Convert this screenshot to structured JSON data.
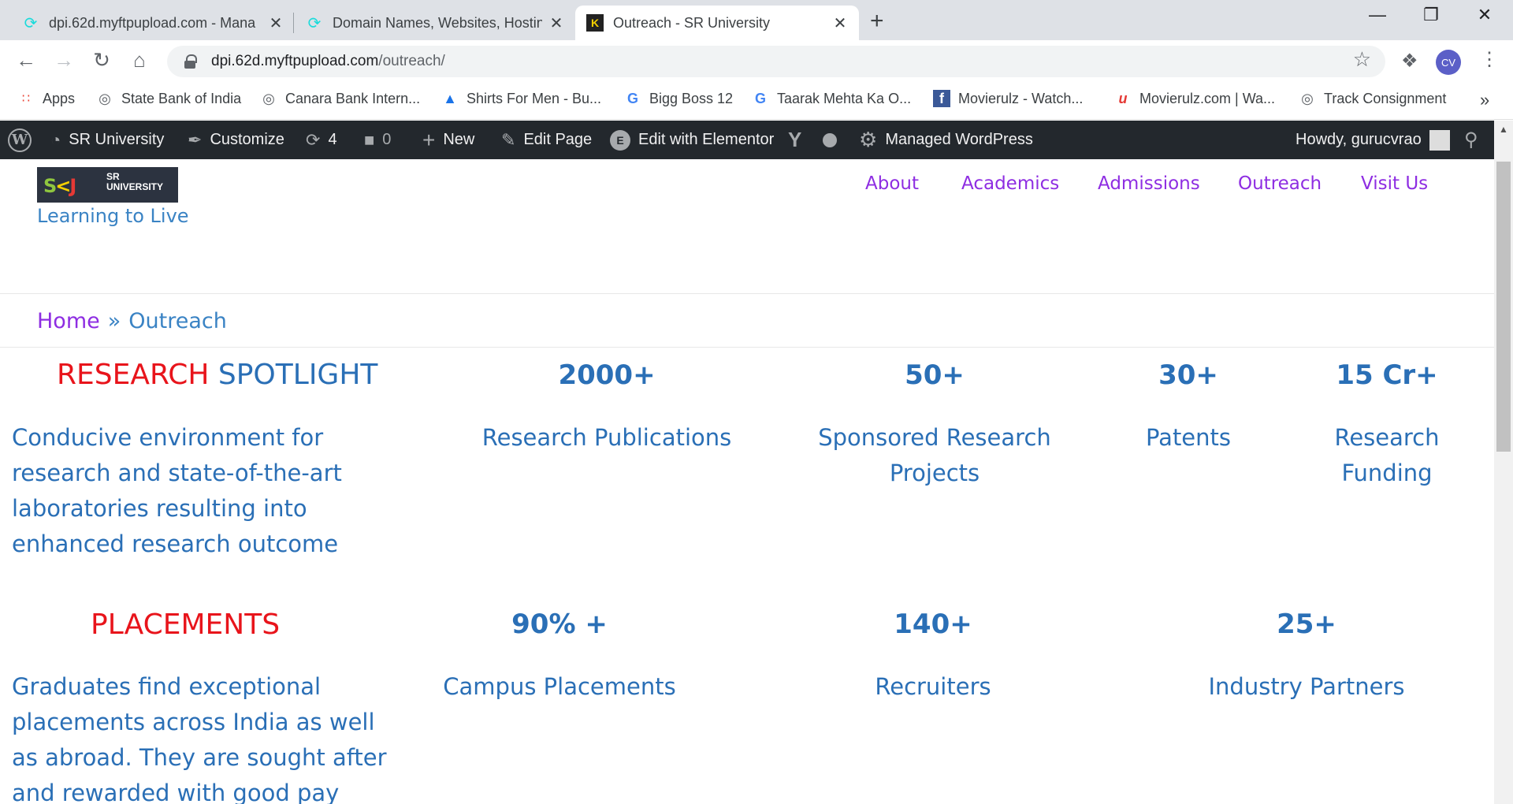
{
  "browser": {
    "tabs": [
      {
        "title": "dpi.62d.myftpupload.com - Mana",
        "icon": "godaddy-icon"
      },
      {
        "title": "Domain Names, Websites, Hostin",
        "icon": "godaddy-icon"
      },
      {
        "title": "Outreach - SR University",
        "icon": "sru-favicon"
      }
    ],
    "url_host": "dpi.62d.myftpupload.com",
    "url_path": "/outreach/",
    "profile_initials": "CV"
  },
  "bookmarks": [
    {
      "label": "Apps",
      "icon": "apps-grid-icon"
    },
    {
      "label": "State Bank of India",
      "icon": "globe-icon"
    },
    {
      "label": "Canara Bank Intern...",
      "icon": "globe-icon"
    },
    {
      "label": "Shirts For Men - Bu...",
      "icon": "triangle-icon"
    },
    {
      "label": "Bigg Boss 12",
      "icon": "google-icon"
    },
    {
      "label": "Taarak Mehta Ka O...",
      "icon": "google-icon"
    },
    {
      "label": "Movierulz - Watch...",
      "icon": "facebook-icon"
    },
    {
      "label": "Movierulz.com | Wa...",
      "icon": "movierulz-icon"
    },
    {
      "label": "Track Consignment",
      "icon": "globe-icon"
    }
  ],
  "adminbar": {
    "site": "SR University",
    "customize": "Customize",
    "updates": "4",
    "comments": "0",
    "new": "New",
    "edit_page": "Edit Page",
    "edit_elementor": "Edit with Elementor",
    "managed": "Managed WordPress",
    "howdy": "Howdy, gurucvrao"
  },
  "site": {
    "logo_text": "SR\nUNIVERSITY",
    "tagline": "Learning to Live",
    "nav": [
      "About",
      "Academics",
      "Admissions",
      "Outreach",
      "Visit Us"
    ],
    "breadcrumb": {
      "home": "Home",
      "sep": "»",
      "current": "Outreach"
    }
  },
  "research": {
    "heading_red": "RESEARCH",
    "heading_blue": "SPOTLIGHT",
    "description": "Conducive environment for research and state-of-the-art laboratories resulting into enhanced research outcome",
    "stats": [
      {
        "value": "2000+",
        "label": "Research Publications"
      },
      {
        "value": "50+",
        "label": "Sponsored Research Projects"
      },
      {
        "value": "30+",
        "label": "Patents"
      },
      {
        "value": "15 Cr+",
        "label": "Research Funding"
      }
    ]
  },
  "placements": {
    "heading": "PLACEMENTS",
    "description": "Graduates find exceptional placements across India as well as abroad. They are sought after and rewarded with good pay",
    "stats": [
      {
        "value": "90% +",
        "label": "Campus Placements"
      },
      {
        "value": "140+",
        "label": "Recruiters"
      },
      {
        "value": "25+",
        "label": "Industry Partners"
      }
    ]
  }
}
